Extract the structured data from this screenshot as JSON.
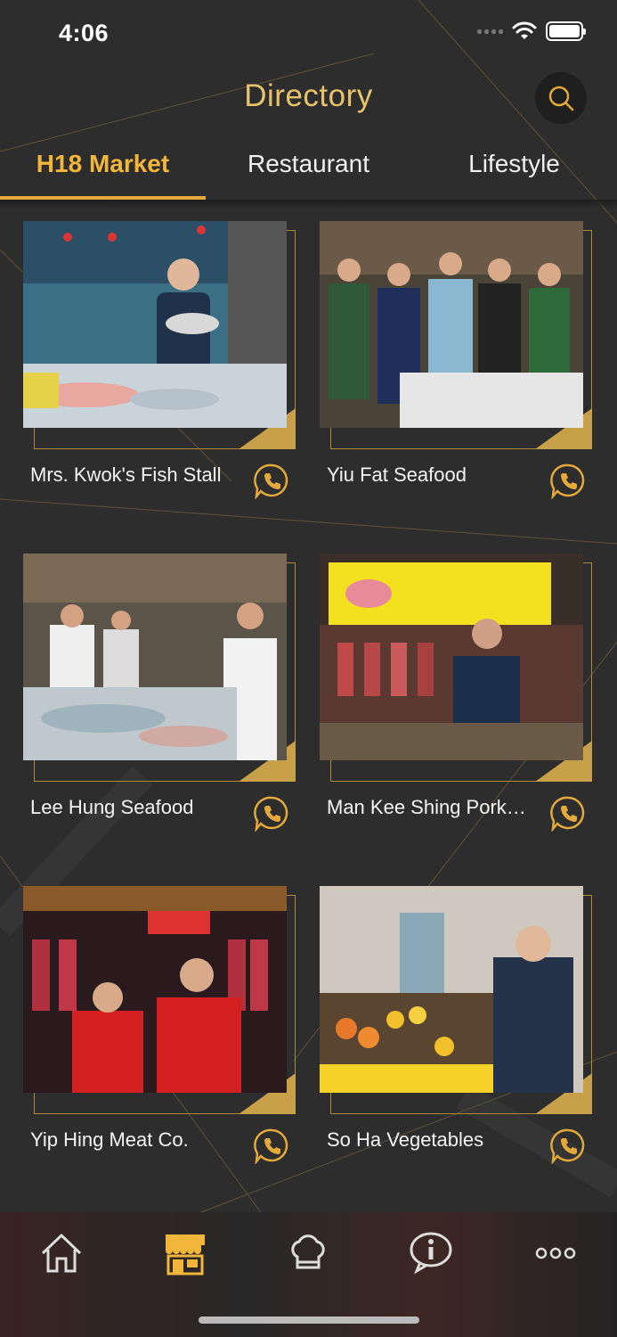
{
  "status_bar": {
    "time": "4:06"
  },
  "header": {
    "title": "Directory"
  },
  "tabs": [
    {
      "label": "H18 Market",
      "active": true
    },
    {
      "label": "Restaurant",
      "active": false
    },
    {
      "label": "Lifestyle",
      "active": false
    }
  ],
  "stalls": [
    {
      "name": "Mrs. Kwok's Fish Stall"
    },
    {
      "name": "Yiu Fat Seafood"
    },
    {
      "name": "Lee Hung Seafood"
    },
    {
      "name": "Man Kee Shing Pork…"
    },
    {
      "name": "Yip Hing Meat Co."
    },
    {
      "name": "So Ha Vegetables"
    }
  ],
  "bottom_nav": [
    {
      "icon": "home-icon",
      "active": false
    },
    {
      "icon": "market-stall-icon",
      "active": true
    },
    {
      "icon": "chef-hat-icon",
      "active": false
    },
    {
      "icon": "info-icon",
      "active": false
    },
    {
      "icon": "more-icon",
      "active": false
    }
  ],
  "colors": {
    "accent": "#f1b63a",
    "title": "#e8c36a",
    "background": "#2d2d2d"
  }
}
